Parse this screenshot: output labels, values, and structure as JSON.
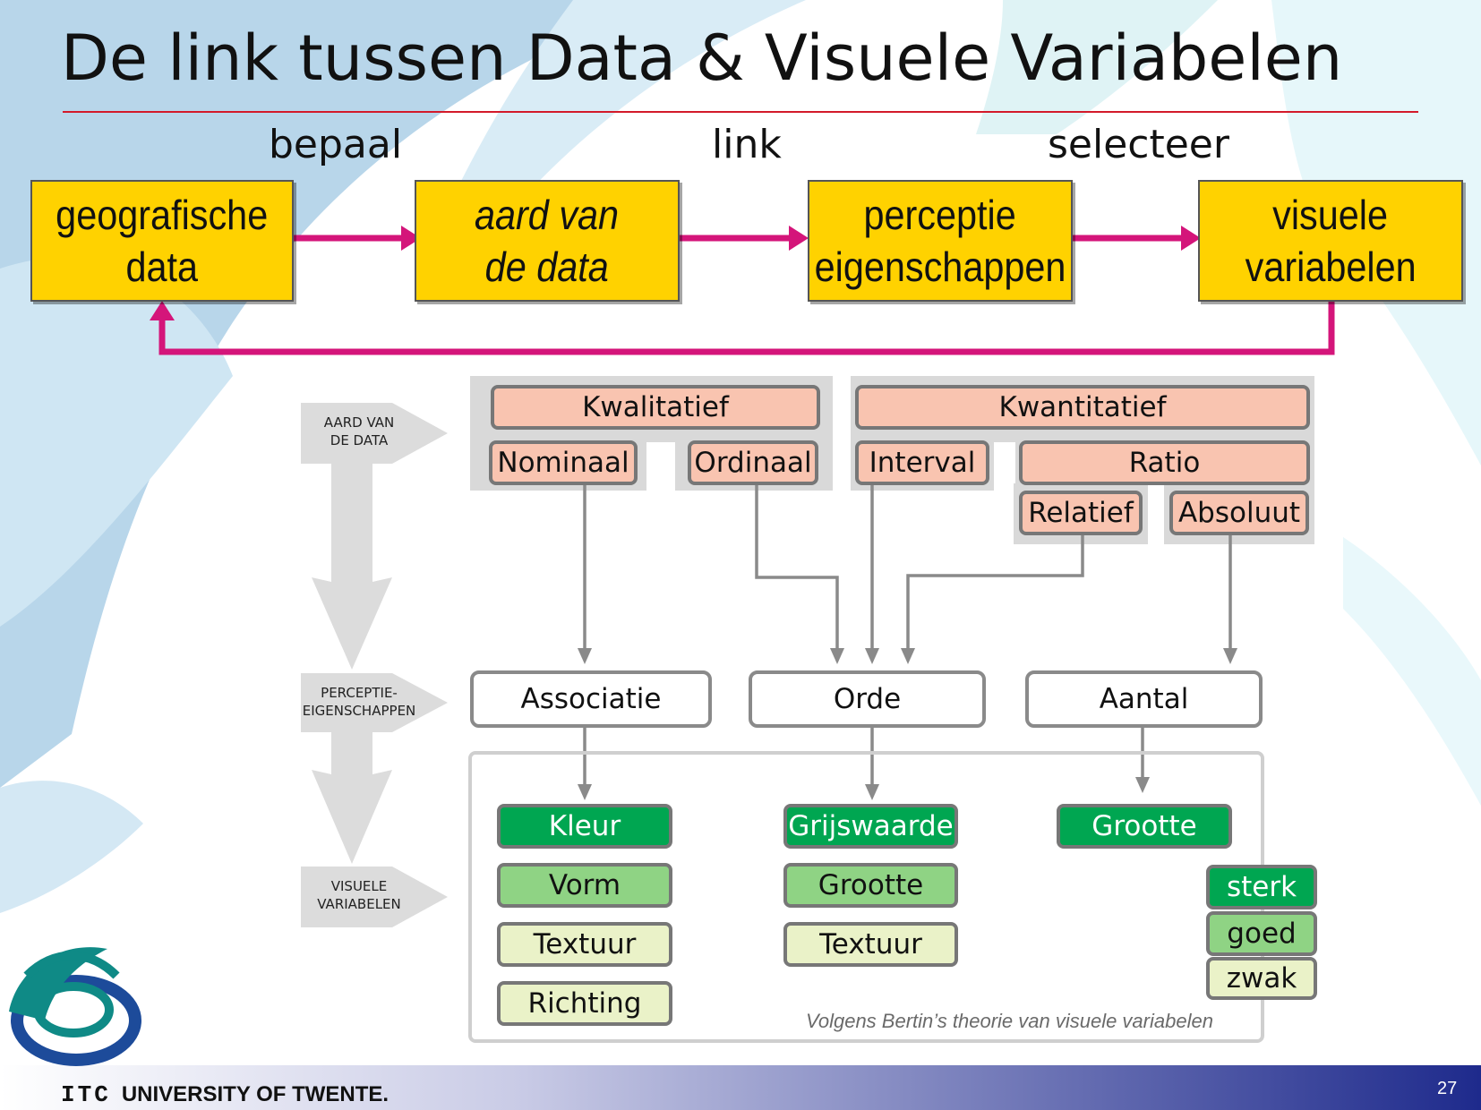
{
  "title": "De link tussen Data & Visuele Variabelen",
  "steps": {
    "verbs": [
      "bepaal",
      "link",
      "selecteer"
    ],
    "boxes": [
      {
        "line1": "geografische",
        "line2": "data"
      },
      {
        "line1": "aard van",
        "line2": "de data"
      },
      {
        "line1": "perceptie",
        "line2": "eigenschappen"
      },
      {
        "line1": "visuele",
        "line2": "variabelen"
      }
    ]
  },
  "side_labels": {
    "data_nature": {
      "line1": "AARD VAN",
      "line2": "DE DATA"
    },
    "perception": {
      "line1": "PERCEPTIE-",
      "line2": "EIGENSCHAPPEN"
    },
    "visual": {
      "line1": "VISUELE",
      "line2": "VARIABELEN"
    }
  },
  "data_types": {
    "qualitative": "Kwalitatief",
    "quantitative": "Kwantitatief",
    "nominal": "Nominaal",
    "ordinal": "Ordinaal",
    "interval": "Interval",
    "ratio": "Ratio",
    "relative": "Relatief",
    "absolute": "Absoluut"
  },
  "perception": {
    "association": "Associatie",
    "order": "Orde",
    "quantity": "Aantal"
  },
  "visual_variables": {
    "association": [
      "Kleur",
      "Vorm",
      "Textuur",
      "Richting"
    ],
    "order": [
      "Grijswaarde",
      "Grootte",
      "Textuur"
    ],
    "quantity": [
      "Grootte"
    ]
  },
  "legend": {
    "strong": "sterk",
    "good": "goed",
    "weak": "zwak"
  },
  "note": "Volgens Bertin’s theorie van visuele variabelen",
  "footer": {
    "brand_logo": "ITC",
    "brand_text": "UNIVERSITY OF TWENTE.",
    "page": "27"
  },
  "colors": {
    "box_yellow": "#ffd200",
    "arrow_magenta": "#d4157a",
    "strong_green": "#00a651",
    "good_green": "#8fd384",
    "weak_green": "#eaf2c8",
    "salmon": "#f9c4b0"
  }
}
